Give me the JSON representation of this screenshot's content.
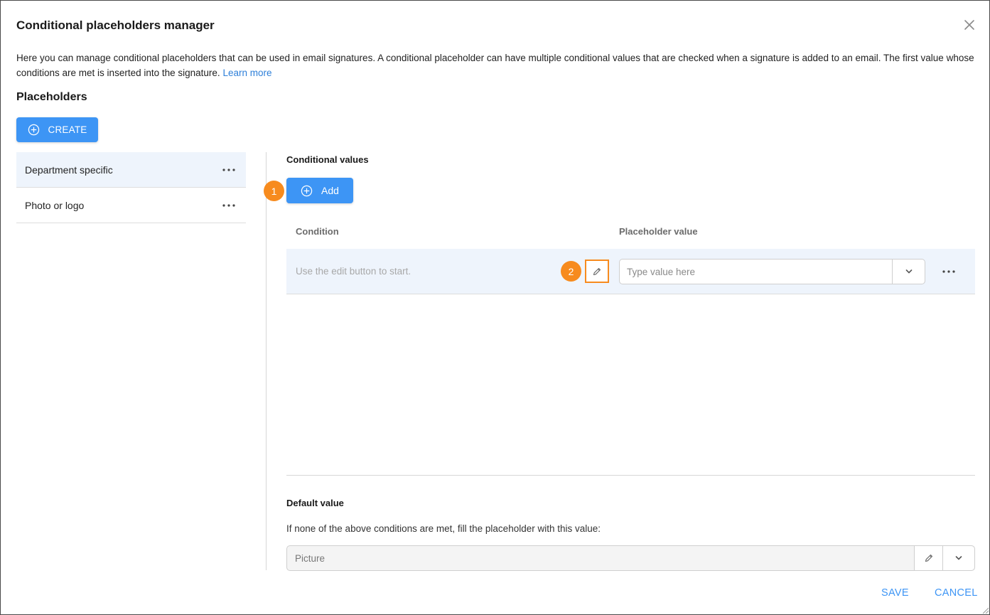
{
  "dialog": {
    "title": "Conditional placeholders manager",
    "description": "Here you can manage conditional placeholders that can be used in email signatures. A conditional placeholder can have multiple conditional values that are checked when a signature is added to an email. The first value whose conditions are met is inserted into the signature.",
    "learn_more": "Learn more",
    "close_icon": "close-icon"
  },
  "placeholders": {
    "title": "Placeholders",
    "create_label": "CREATE",
    "items": [
      {
        "label": "Department specific",
        "selected": true
      },
      {
        "label": "Photo or logo",
        "selected": false
      }
    ]
  },
  "conditional_values": {
    "title": "Conditional values",
    "add_label": "Add",
    "columns": {
      "condition": "Condition",
      "value": "Placeholder value"
    },
    "rows": [
      {
        "condition_hint": "Use the edit button to start.",
        "value": "",
        "value_placeholder": "Type value here"
      }
    ]
  },
  "default_value": {
    "title": "Default value",
    "description": "If none of the above conditions are met, fill the placeholder with this value:",
    "value": "Picture"
  },
  "annotations": {
    "step1": "1",
    "step2": "2",
    "color": "#f78b1e"
  },
  "footer": {
    "save_label": "SAVE",
    "cancel_label": "CANCEL"
  },
  "colors": {
    "accent": "#3d95f5",
    "selected_bg": "#eef4fc",
    "link": "#2d7fd9"
  }
}
